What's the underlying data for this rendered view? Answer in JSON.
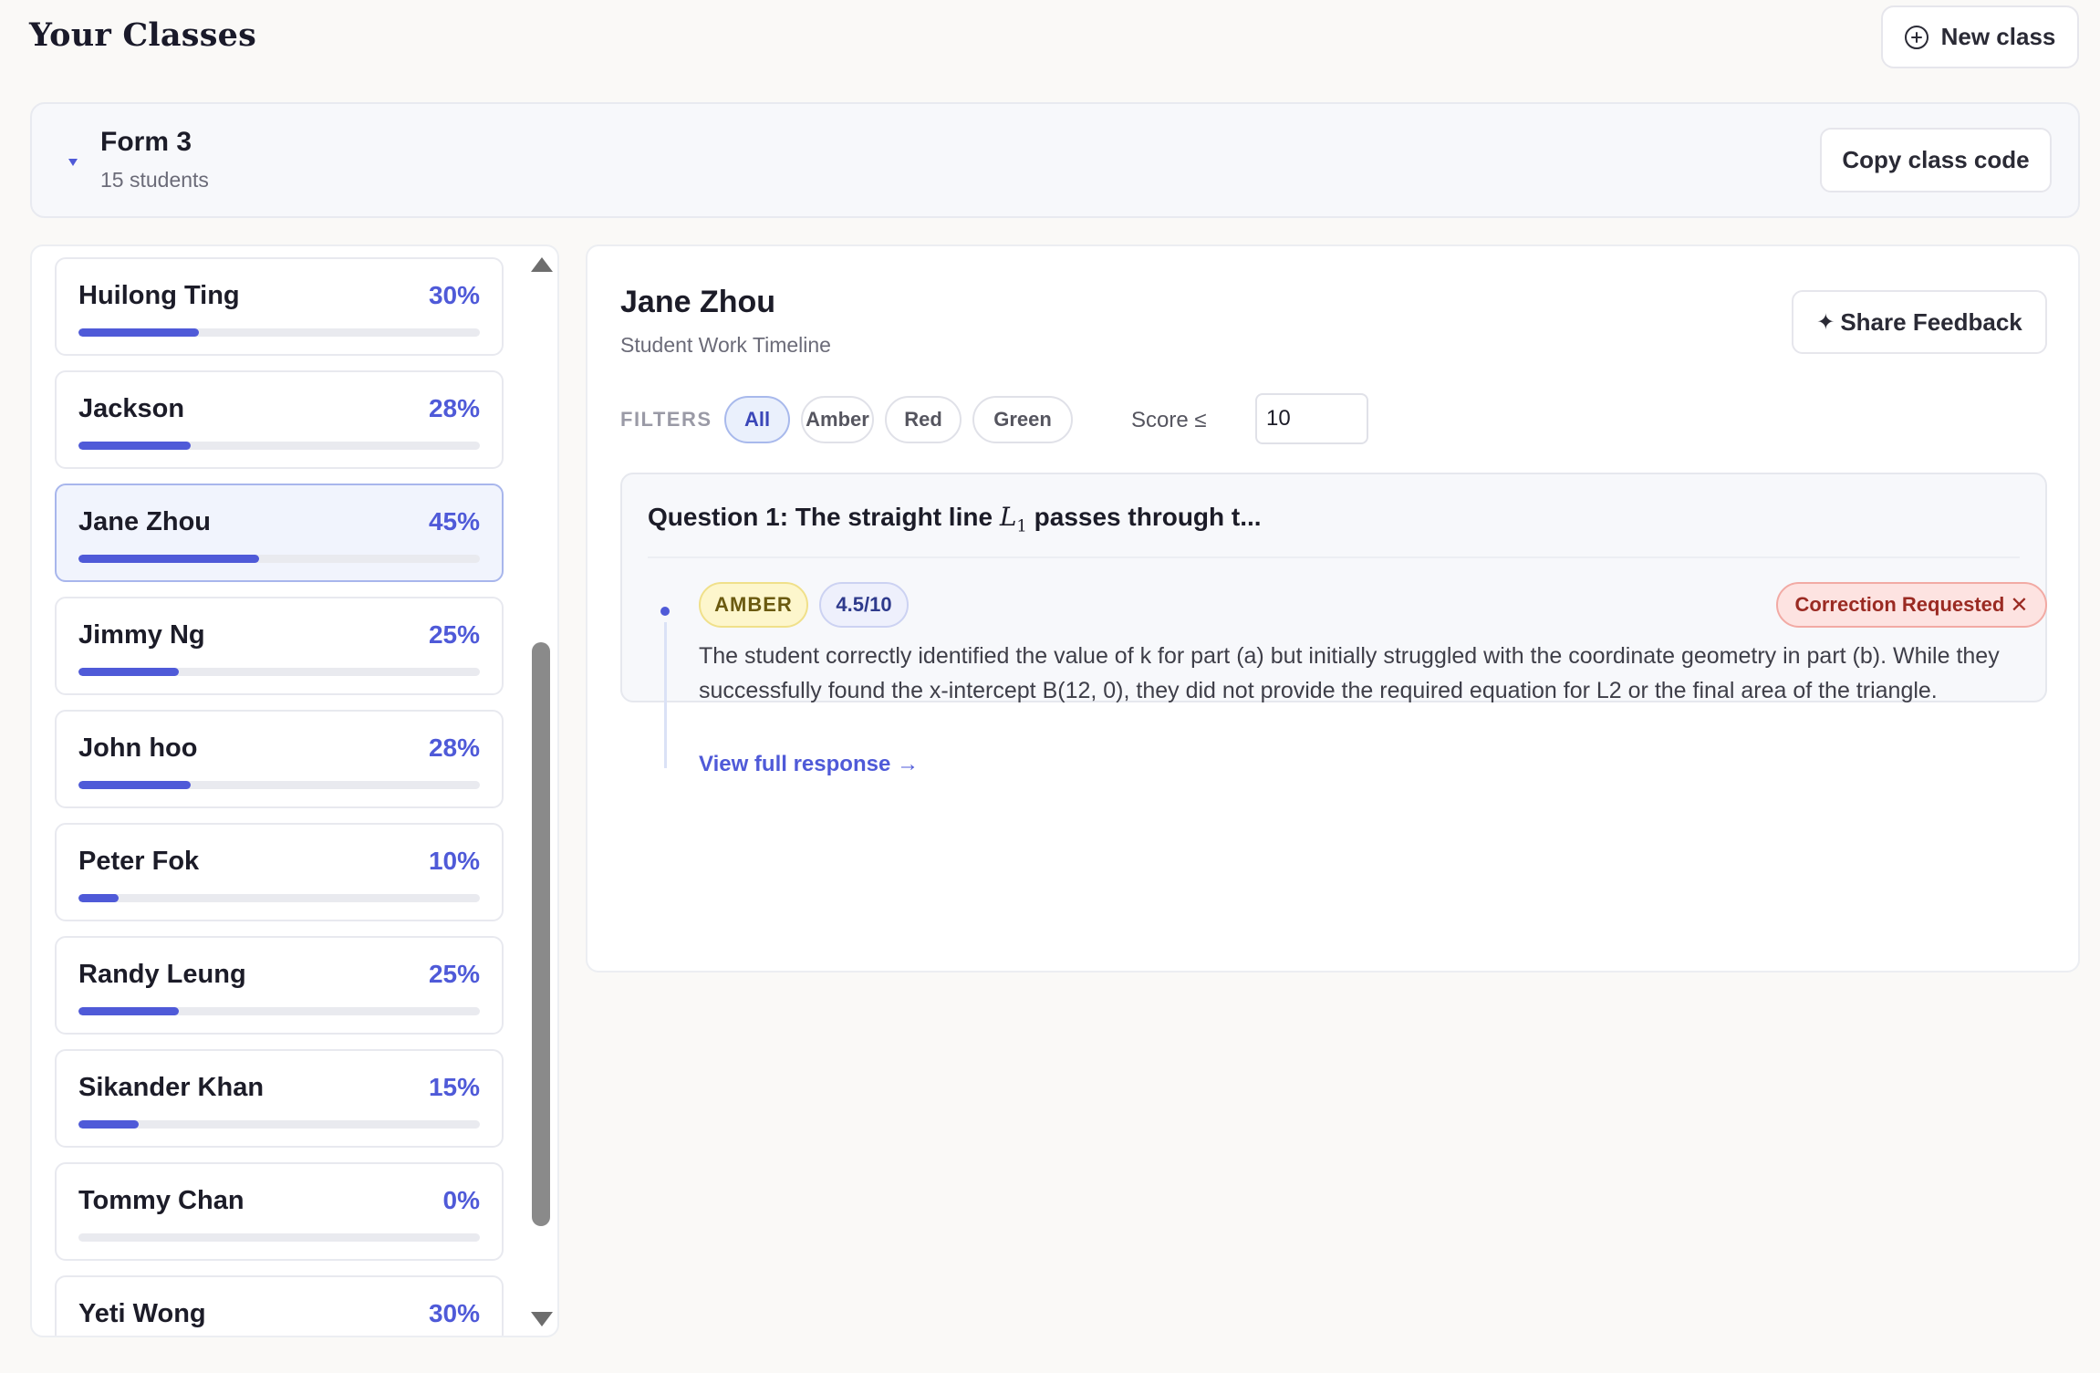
{
  "header": {
    "title": "Your Classes",
    "new_class_label": "New class"
  },
  "class": {
    "name": "Form 3",
    "student_count": "15 students",
    "copy_code_label": "Copy class code"
  },
  "students": [
    {
      "name": "Huilong Ting",
      "percent": "30%",
      "progress": 0.3
    },
    {
      "name": "Jackson",
      "percent": "28%",
      "progress": 0.28
    },
    {
      "name": "Jane Zhou",
      "percent": "45%",
      "progress": 0.45,
      "selected": true
    },
    {
      "name": "Jimmy Ng",
      "percent": "25%",
      "progress": 0.25
    },
    {
      "name": "John hoo",
      "percent": "28%",
      "progress": 0.28
    },
    {
      "name": "Peter Fok",
      "percent": "10%",
      "progress": 0.1
    },
    {
      "name": "Randy Leung",
      "percent": "25%",
      "progress": 0.25
    },
    {
      "name": "Sikander Khan",
      "percent": "15%",
      "progress": 0.15
    },
    {
      "name": "Tommy Chan",
      "percent": "0%",
      "progress": 0.0
    },
    {
      "name": "Yeti Wong",
      "percent": "30%",
      "progress": 0.3
    }
  ],
  "detail": {
    "student_name": "Jane Zhou",
    "subtitle": "Student Work Timeline",
    "share_label": "Share Feedback",
    "filters": {
      "label": "FILTERS",
      "chips": [
        "All",
        "Amber",
        "Red",
        "Green"
      ],
      "active": "All",
      "score_label": "Score ≤",
      "score_value": "10"
    },
    "question": {
      "prefix": "Question 1: The straight line ",
      "math_var": "L",
      "math_sub": "1",
      "suffix": " passes through t...",
      "status": "AMBER",
      "score": "4.5/10",
      "correction_label": "Correction Requested",
      "feedback": "The student correctly identified the value of k for part (a) but initially struggled with the coordinate geometry in part (b). While they successfully found the x-intercept B(12, 0), they did not provide the required equation for L2 or the final area of the triangle.",
      "view_link": "View full response →"
    }
  },
  "icons": {
    "new_class": "plus-circle-icon",
    "expand": "caret-down-icon",
    "share": "sparkle-icon",
    "remove": "close-icon"
  },
  "colors": {
    "accent": "#4f5ad8",
    "amber_bg": "#fdf6cc",
    "correction_bg": "#fde3e1"
  }
}
